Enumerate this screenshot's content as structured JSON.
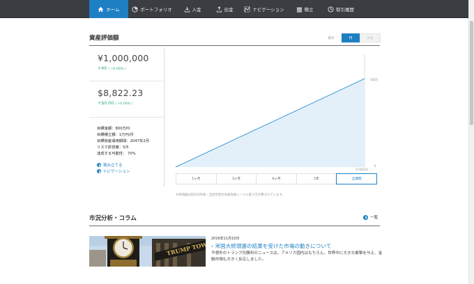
{
  "nav": {
    "items": [
      {
        "label": "ホーム",
        "icon": "home-icon",
        "active": true
      },
      {
        "label": "ポートフォリオ",
        "icon": "pie-chart-icon",
        "active": false
      },
      {
        "label": "入金",
        "icon": "deposit-icon",
        "active": false
      },
      {
        "label": "出金",
        "icon": "withdraw-icon",
        "active": false
      },
      {
        "label": "ナビゲーション",
        "icon": "navigation-icon",
        "active": false
      },
      {
        "label": "積立",
        "icon": "savings-icon",
        "active": false
      },
      {
        "label": "取引履歴",
        "icon": "clock-icon",
        "active": false
      }
    ]
  },
  "assets": {
    "title": "資産評価額",
    "currency_toggle": [
      "表示",
      "円",
      "ドル"
    ],
    "currency_selected": "円",
    "jpy": {
      "amount": "¥1,000,000",
      "delta": "+¥0",
      "delta_pct": "( +0.00% )"
    },
    "usd": {
      "amount": "$8,822.23",
      "delta": "+$0.00",
      "delta_pct": "( +0.00% )"
    },
    "goals": [
      "目標金額：800万円",
      "目標積立額：1万円/月",
      "目標資産運用期間：2047年2月",
      "リスク許容度：5/5",
      "達成する可能性： 70%"
    ],
    "links": [
      "積み立てる",
      "ナビゲーション"
    ]
  },
  "chart_data": {
    "type": "area",
    "x": [
      "",
      "17/02/23"
    ],
    "series": [
      {
        "values": [
          0,
          100
        ]
      }
    ],
    "y_tick_labels": [
      "0",
      "100万"
    ],
    "range_tabs": [
      "1ヶ月",
      "3ヶ月",
      "6ヶ月",
      "1年",
      "全期間"
    ],
    "range_selected": "全期間",
    "colors": {
      "line": "#3e9bd4",
      "fill": "#e3f0fa"
    }
  },
  "note": "※評価額は前日の時価・当社所定の為替為替レートに基づき計算されています。",
  "market": {
    "title": "市況分析・コラム",
    "more_label": "一覧",
    "article": {
      "date": "2016年11月10日",
      "title": "米国大統領選の結果を受けた市場の動きについて",
      "body": "予想外のトランプ氏勝利のニュースは、アメリカ国内はもちろん、世界中に大きな衝撃を与え、金融市場も大きく反応しました。"
    }
  },
  "colors": {
    "accent": "#1e7fc2",
    "nav_bg": "#3a3d42",
    "positive": "#2aa77c"
  }
}
